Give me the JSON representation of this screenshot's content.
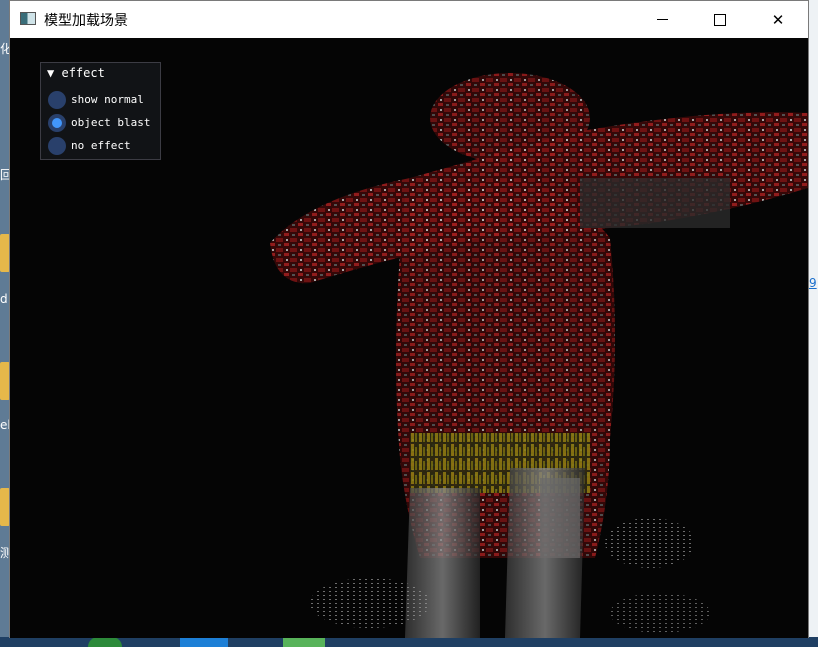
{
  "window": {
    "title": "模型加载场景",
    "icon": "app-window-icon",
    "controls": {
      "minimize_icon": "minimize-icon",
      "maximize_icon": "maximize-icon",
      "close_icon": "close-icon",
      "close_glyph": "✕"
    }
  },
  "desktop": {
    "left_labels": [
      "化",
      "回",
      "d",
      "el",
      "测"
    ],
    "right_link": "9"
  },
  "panel": {
    "header_arrow": "▼",
    "header_label": "effect",
    "options": [
      {
        "label": "show normal",
        "selected": false
      },
      {
        "label": "object blast",
        "selected": true
      },
      {
        "label": "no effect",
        "selected": false
      }
    ]
  },
  "colors": {
    "radio_bg": "#29406b",
    "radio_active": "#4296fa",
    "model_red": "#7a1414",
    "model_yellow": "#8a7a12",
    "model_grey": "#7d7d7d"
  }
}
